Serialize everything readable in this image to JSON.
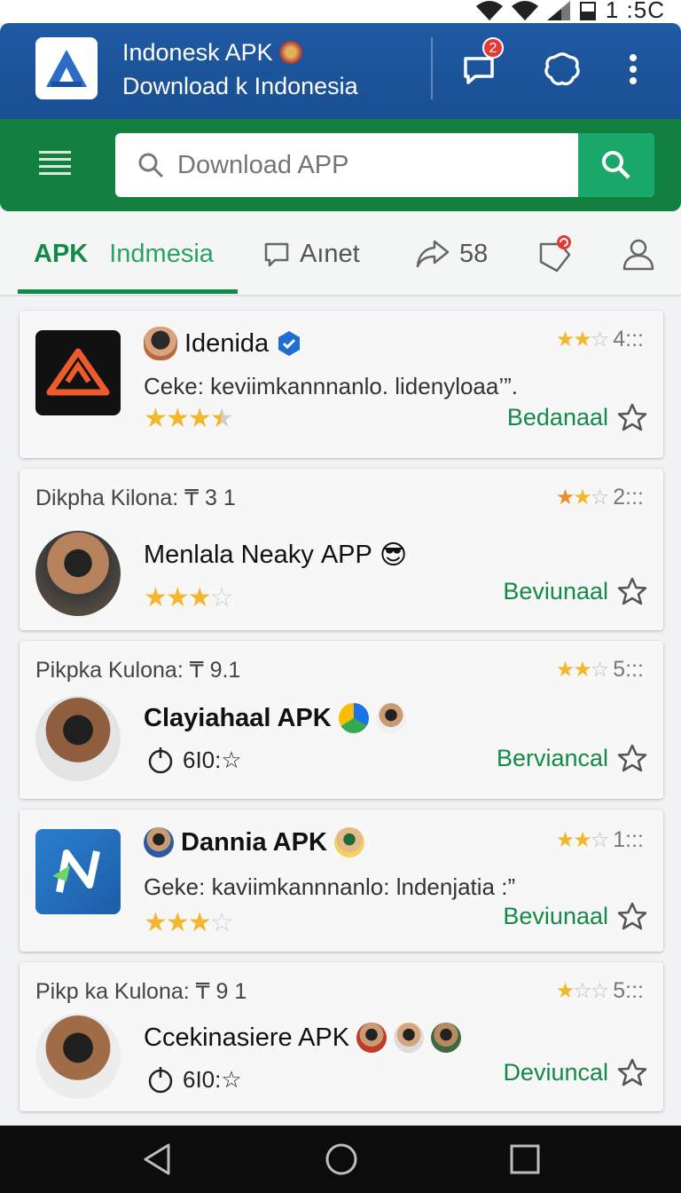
{
  "status_bar": {
    "time": "1 :5C"
  },
  "header": {
    "title_line1": "Indonesk APK",
    "title_line2": "Download k Indonesia",
    "chat_badge": "2"
  },
  "search": {
    "placeholder": "Download APP"
  },
  "tabs": [
    {
      "label": "APK",
      "label2": "Indmesia",
      "active": true
    },
    {
      "label": "Aınet"
    },
    {
      "label": "58"
    },
    {
      "label": "",
      "badge_icon": "refresh-badge"
    },
    {
      "label": ""
    }
  ],
  "apps": [
    {
      "name": "Idenida",
      "description": "Ceke: keviimkannnanlo. lidenyloaa’”.",
      "rating_right": "4:::",
      "action": "Bedanaal",
      "stars": 3.5
    },
    {
      "subtitle": "Dikpha Kilona: ₸ 3 1",
      "name": "Menlala Neaky",
      "name_suffix": "APP",
      "rating_right": "2:::",
      "action": "Beviunaal",
      "stars": 3.5
    },
    {
      "subtitle": "Pikpka Kulona: ₸ 9.1",
      "name": "Clayiahaal APK",
      "timer": "6I0:☆",
      "rating_right": "5:::",
      "action": "Berviancal"
    },
    {
      "name": "Dannia APK",
      "description": "Geke: kaviimkannnanlo: lndenjatia :”",
      "rating_right": "1:::",
      "action": "Beviunaal",
      "stars": 3.5
    },
    {
      "subtitle": "Pikp ka Kulona: ₸ 9 1",
      "name": "Ccekinasiere APK",
      "timer": "6I0:☆",
      "rating_right": "5:::",
      "action": "Deviuncal"
    }
  ]
}
